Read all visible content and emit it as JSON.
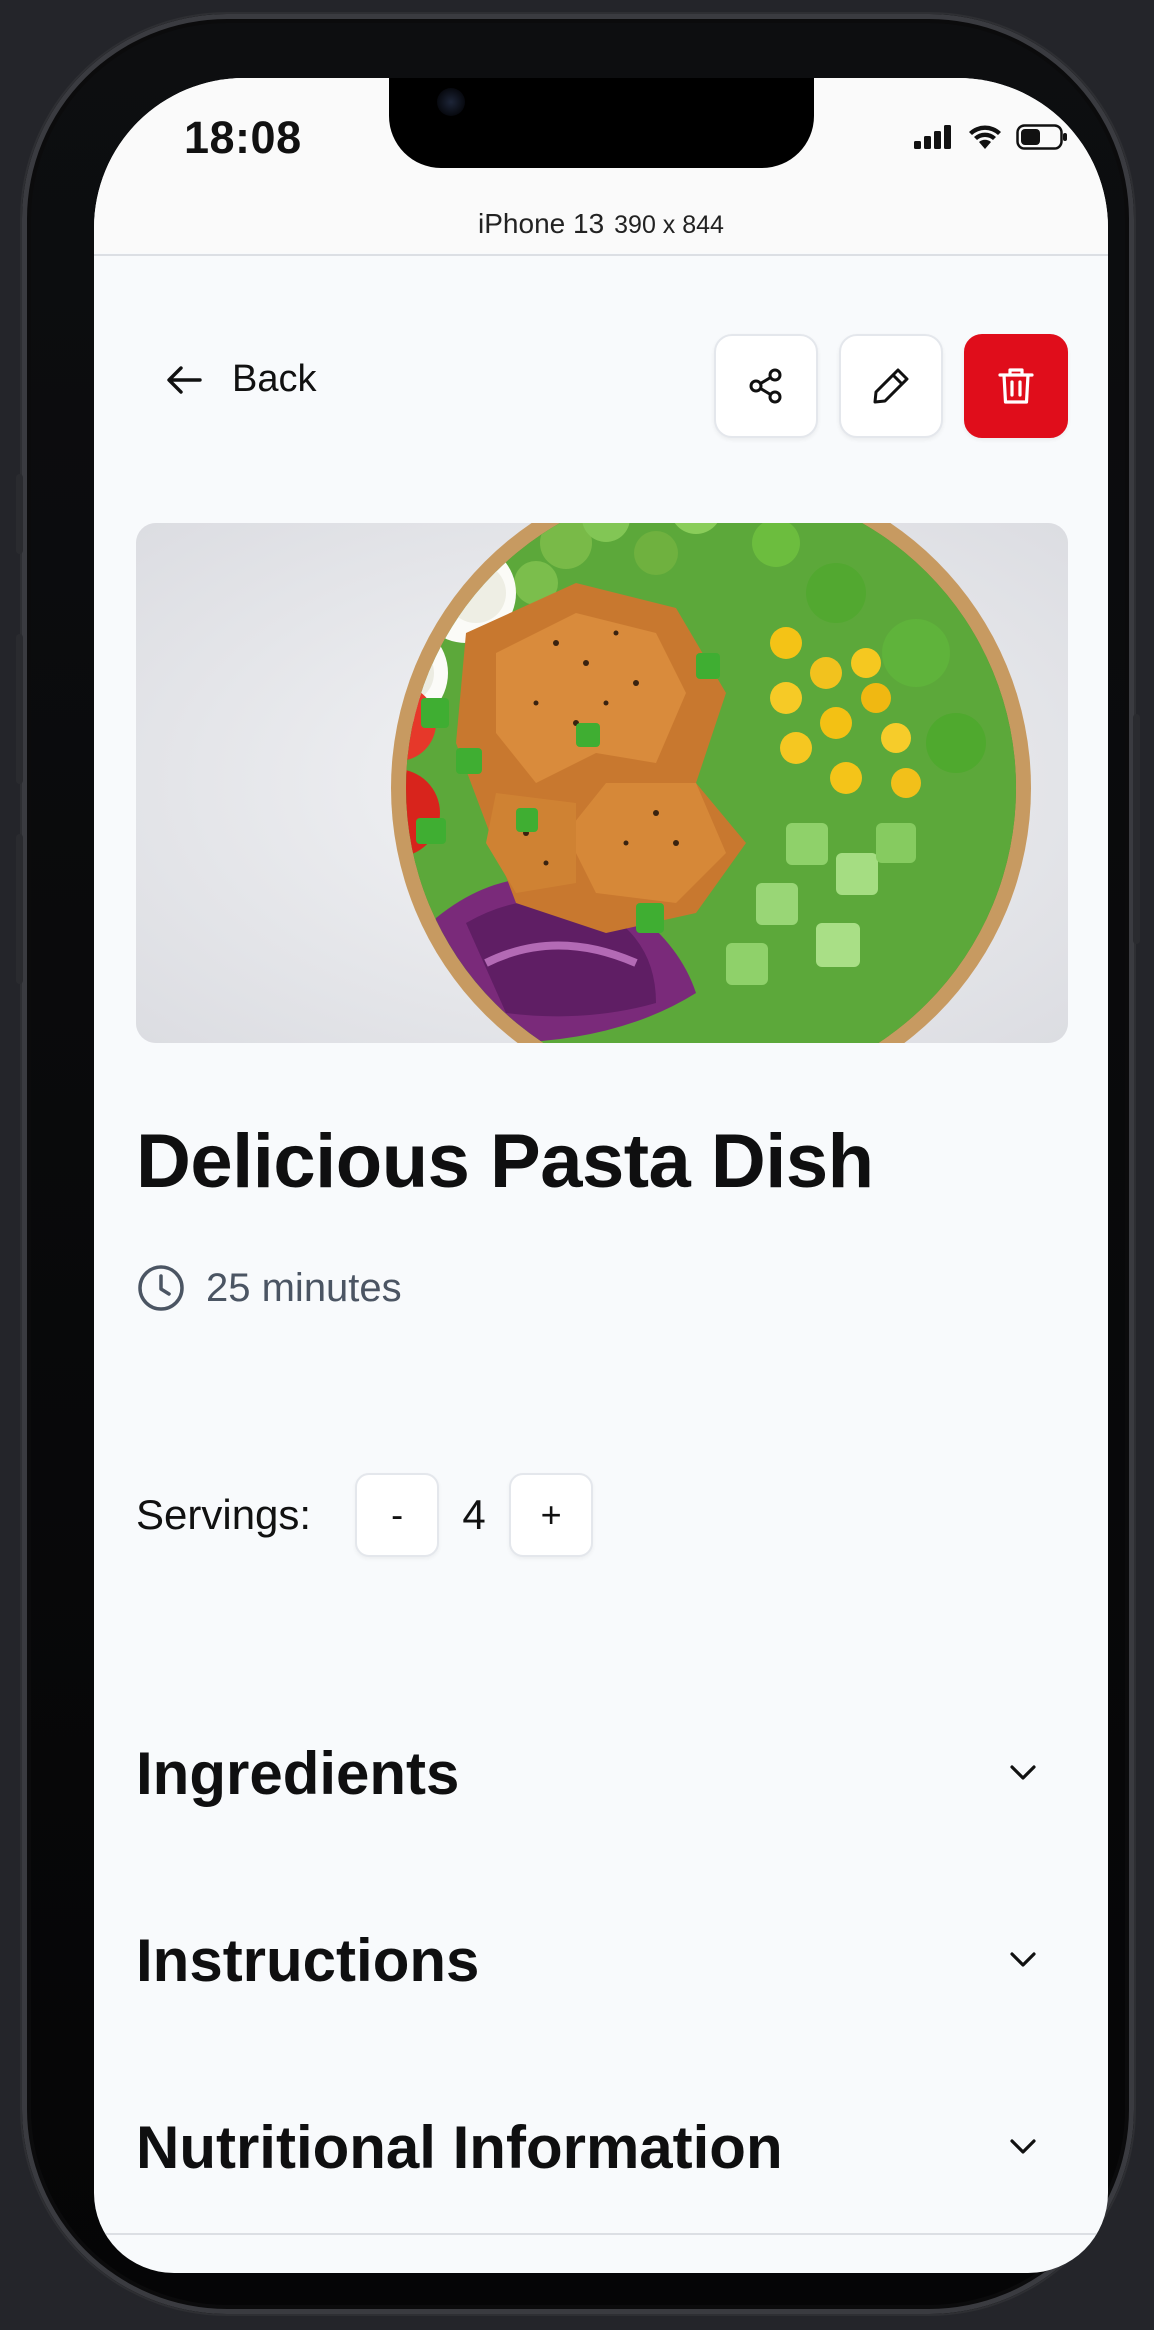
{
  "status_bar": {
    "time": "18:08"
  },
  "device": {
    "name": "iPhone 13",
    "dimensions": "390 x 844"
  },
  "nav": {
    "back_label": "Back"
  },
  "actions": {
    "delete_color": "#e00d1b"
  },
  "recipe": {
    "title": "Delicious Pasta Dish",
    "time": "25 minutes",
    "servings_label": "Servings:",
    "servings_value": "4",
    "decrement_label": "-",
    "increment_label": "+"
  },
  "sections": [
    {
      "label": "Ingredients"
    },
    {
      "label": "Instructions"
    },
    {
      "label": "Nutritional Information"
    }
  ]
}
